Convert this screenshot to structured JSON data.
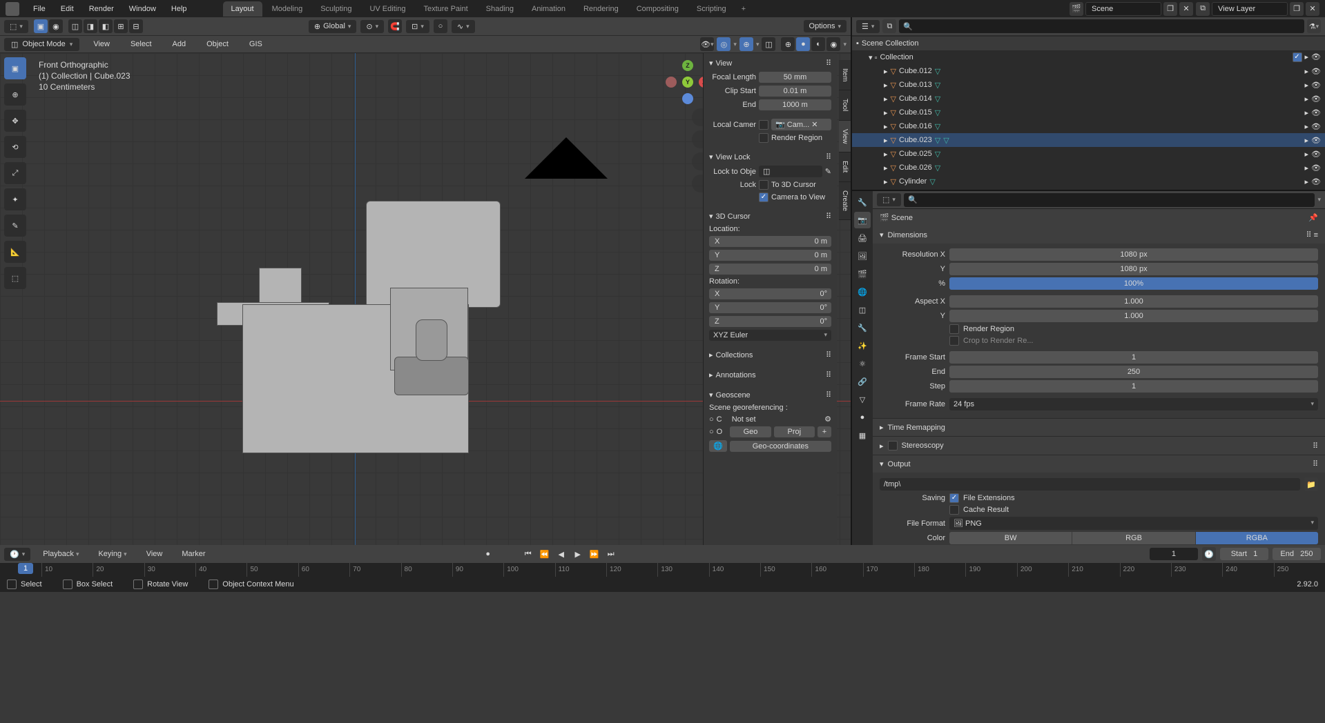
{
  "topbar": {
    "menus": [
      "File",
      "Edit",
      "Render",
      "Window",
      "Help"
    ],
    "workspaces": [
      "Layout",
      "Modeling",
      "Sculpting",
      "UV Editing",
      "Texture Paint",
      "Shading",
      "Animation",
      "Rendering",
      "Compositing",
      "Scripting"
    ],
    "active_workspace": "Layout",
    "scene": "Scene",
    "view_layer": "View Layer"
  },
  "vp_header": {
    "transform": "Global",
    "options": "Options"
  },
  "vp_subheader": {
    "mode": "Object Mode",
    "menus": [
      "View",
      "Select",
      "Add",
      "Object",
      "GIS"
    ]
  },
  "viewport_info": {
    "view_name": "Front Orthographic",
    "collection_path": "(1) Collection | Cube.023",
    "scale": "10 Centimeters"
  },
  "n_panel": {
    "tabs": [
      "Item",
      "Tool",
      "View",
      "Edit",
      "Create"
    ],
    "active_tab": "View",
    "view": {
      "title": "View",
      "focal_label": "Focal Length",
      "focal": "50 mm",
      "clip_start_label": "Clip Start",
      "clip_start": "0.01 m",
      "end_label": "End",
      "end": "1000 m",
      "local_camera_label": "Local Camer",
      "camera_value": "Cam...",
      "render_region": "Render Region"
    },
    "view_lock": {
      "title": "View Lock",
      "lock_to_obj_label": "Lock to Obje",
      "lock_label": "Lock",
      "to_3d_cursor": "To 3D Cursor",
      "cam_to_view": "Camera to View"
    },
    "cursor": {
      "title": "3D Cursor",
      "location_label": "Location:",
      "x": "0 m",
      "y": "0 m",
      "z": "0 m",
      "rotation_label": "Rotation:",
      "rx": "0°",
      "ry": "0°",
      "rz": "0°",
      "rotation_mode": "XYZ Euler"
    },
    "collections_title": "Collections",
    "annotations_title": "Annotations",
    "geoscene": {
      "title": "Geoscene",
      "scene_georef": "Scene georeferencing :",
      "c_label": "C",
      "not_set": "Not set",
      "o_label": "O",
      "geo": "Geo",
      "proj": "Proj",
      "geo_coords": "Geo-coordinates"
    }
  },
  "outliner": {
    "root": "Scene Collection",
    "collection": "Collection",
    "items": [
      "Cube.012",
      "Cube.013",
      "Cube.014",
      "Cube.015",
      "Cube.016",
      "Cube.023",
      "Cube.025",
      "Cube.026",
      "Cylinder"
    ],
    "selected": "Cube.023"
  },
  "properties": {
    "scene_name": "Scene",
    "dimensions": {
      "title": "Dimensions",
      "res_x_label": "Resolution X",
      "res_x": "1080 px",
      "res_y_label": "Y",
      "res_y": "1080 px",
      "pct_label": "%",
      "pct": "100%",
      "aspect_x_label": "Aspect X",
      "aspect_x": "1.000",
      "aspect_y_label": "Y",
      "aspect_y": "1.000",
      "render_region": "Render Region",
      "crop": "Crop to Render Re...",
      "frame_start_label": "Frame Start",
      "frame_start": "1",
      "end_label": "End",
      "end": "250",
      "step_label": "Step",
      "step": "1",
      "frame_rate_label": "Frame Rate",
      "frame_rate": "24 fps"
    },
    "time_remapping": "Time Remapping",
    "stereoscopy": "Stereoscopy",
    "output": {
      "title": "Output",
      "path": "/tmp\\",
      "saving_label": "Saving",
      "file_ext": "File Extensions",
      "cache_result": "Cache Result",
      "file_format_label": "File Format",
      "file_format": "PNG",
      "color_label": "Color",
      "color_modes": [
        "BW",
        "RGB",
        "RGBA"
      ]
    }
  },
  "timeline": {
    "playback": "Playback",
    "keying": "Keying",
    "view": "View",
    "marker": "Marker",
    "current_frame": "1",
    "start_label": "Start",
    "start": "1",
    "end_label": "End",
    "end": "250",
    "ticks": [
      "10",
      "20",
      "30",
      "40",
      "50",
      "60",
      "70",
      "80",
      "90",
      "100",
      "110",
      "120",
      "130",
      "140",
      "150",
      "160",
      "170",
      "180",
      "190",
      "200",
      "210",
      "220",
      "230",
      "240",
      "250"
    ]
  },
  "statusbar": {
    "select": "Select",
    "box_select": "Box Select",
    "rotate": "Rotate View",
    "context_menu": "Object Context Menu",
    "version": "2.92.0"
  }
}
